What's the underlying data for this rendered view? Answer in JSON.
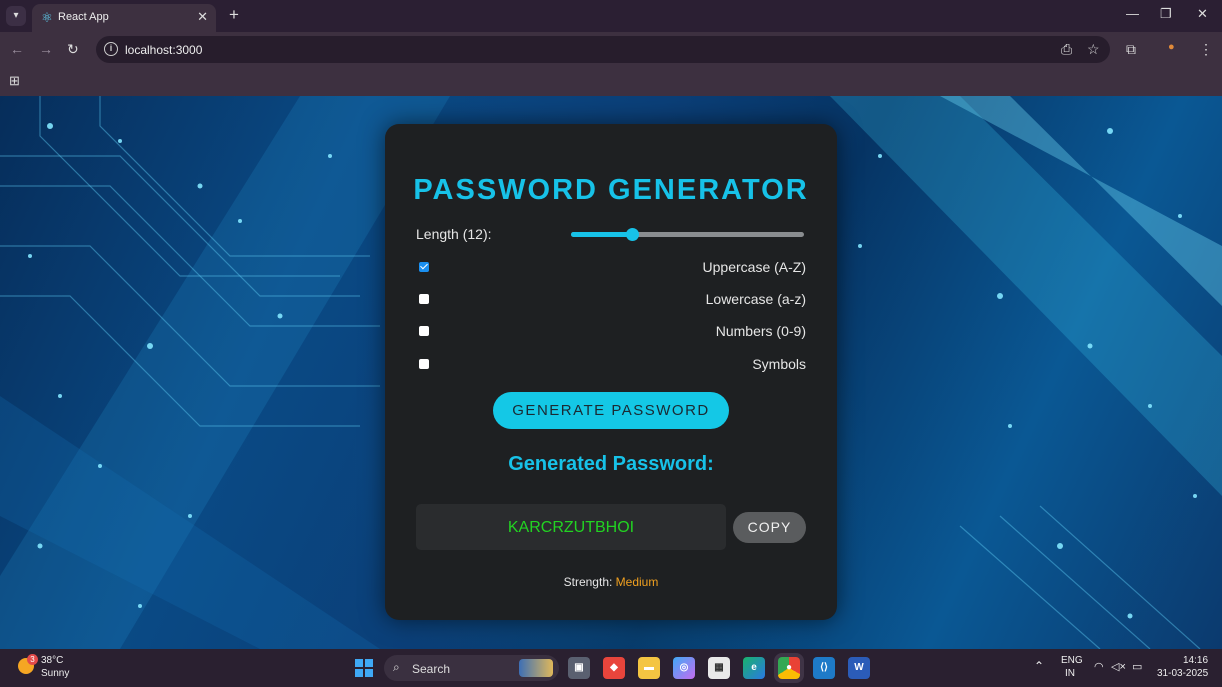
{
  "browser": {
    "tab_title": "React App",
    "url": "localhost:3000"
  },
  "app": {
    "title": "PASSWORD GENERATOR",
    "length_label": "Length (12):",
    "length_value": 12,
    "length_fraction": 0.26,
    "options": [
      {
        "label": "Uppercase (A-Z)",
        "checked": true
      },
      {
        "label": "Lowercase (a-z)",
        "checked": false
      },
      {
        "label": "Numbers (0-9)",
        "checked": false
      },
      {
        "label": "Symbols",
        "checked": false
      }
    ],
    "generate_label": "GENERATE PASSWORD",
    "generated_title": "Generated Password:",
    "password": "KARCRZUTBHOI",
    "copy_label": "COPY",
    "strength_label": "Strength:",
    "strength_value": "Medium",
    "colors": {
      "accent": "#17c2e8",
      "password": "#22d322",
      "strength": "#f0a020",
      "card": "#1e2022"
    }
  },
  "taskbar": {
    "weather_temp": "38°C",
    "weather_cond": "Sunny",
    "weather_badge": "3",
    "search_placeholder": "Search",
    "lang_top": "ENG",
    "lang_bottom": "IN",
    "time": "14:16",
    "date": "31-03-2025"
  }
}
